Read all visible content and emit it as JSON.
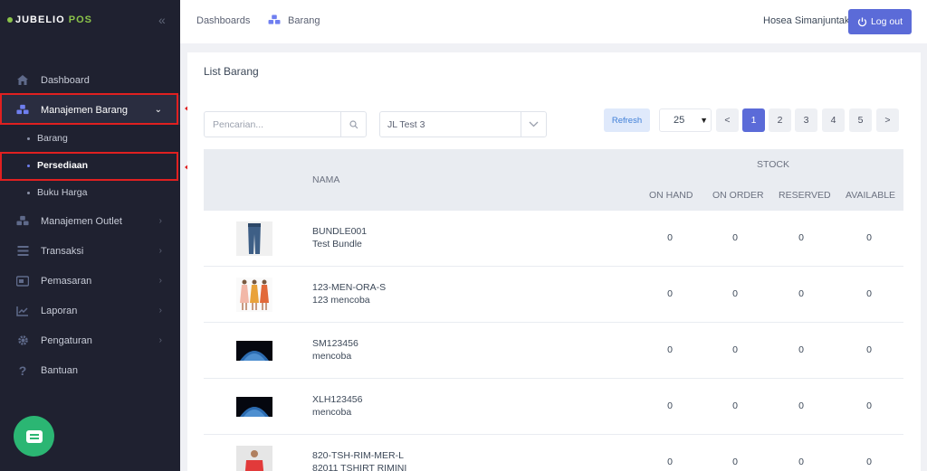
{
  "brand": {
    "name": "JUBELIO",
    "suffix": "POS"
  },
  "sidebar": {
    "items": [
      {
        "label": "Dashboard",
        "icon": "home-icon"
      },
      {
        "label": "Manajemen Barang",
        "icon": "cubes-icon",
        "active": true
      },
      {
        "label": "Manajemen Outlet",
        "icon": "store-icon"
      },
      {
        "label": "Transaksi",
        "icon": "receipt-icon"
      },
      {
        "label": "Pemasaran",
        "icon": "megaphone-icon"
      },
      {
        "label": "Laporan",
        "icon": "chart-line-icon"
      },
      {
        "label": "Pengaturan",
        "icon": "gear-icon"
      },
      {
        "label": "Bantuan",
        "icon": "question-icon"
      }
    ],
    "subitems": [
      {
        "label": "Barang"
      },
      {
        "label": "Persediaan",
        "active": true
      },
      {
        "label": "Buku Harga"
      }
    ],
    "annotations": [
      "1",
      "2"
    ]
  },
  "topbar": {
    "crumb1": "Dashboards",
    "crumb2": "Barang",
    "user": "Hosea Simanjuntak",
    "logout": "Log out"
  },
  "main": {
    "title": "List Barang",
    "search_placeholder": "Pencarian...",
    "location": "JL Test 3",
    "refresh": "Refresh",
    "per_page": "25",
    "pages": [
      "<",
      "1",
      "2",
      "3",
      "4",
      "5",
      ">"
    ],
    "active_page": "1"
  },
  "table": {
    "col_name": "NAMA",
    "col_stock": "STOCK",
    "stock_cols": [
      "ON HAND",
      "ON ORDER",
      "RESERVED",
      "AVAILABLE"
    ],
    "rows": [
      {
        "sku": "BUNDLE001",
        "name": "Test Bundle",
        "values": [
          "0",
          "0",
          "0",
          "0"
        ],
        "thumb": "jeans"
      },
      {
        "sku": "123-MEN-ORA-S",
        "name": "123 mencoba",
        "values": [
          "0",
          "0",
          "0",
          "0"
        ],
        "thumb": "dresses"
      },
      {
        "sku": "SM123456",
        "name": "mencoba",
        "values": [
          "0",
          "0",
          "0",
          "0"
        ],
        "thumb": "earth"
      },
      {
        "sku": "XLH123456",
        "name": "mencoba",
        "values": [
          "0",
          "0",
          "0",
          "0"
        ],
        "thumb": "earth"
      },
      {
        "sku": "820-TSH-RIM-MER-L",
        "name": "82011 TSHIRT RIMINI",
        "values": [
          "0",
          "0",
          "0",
          "0"
        ],
        "thumb": "tshirt"
      }
    ]
  }
}
